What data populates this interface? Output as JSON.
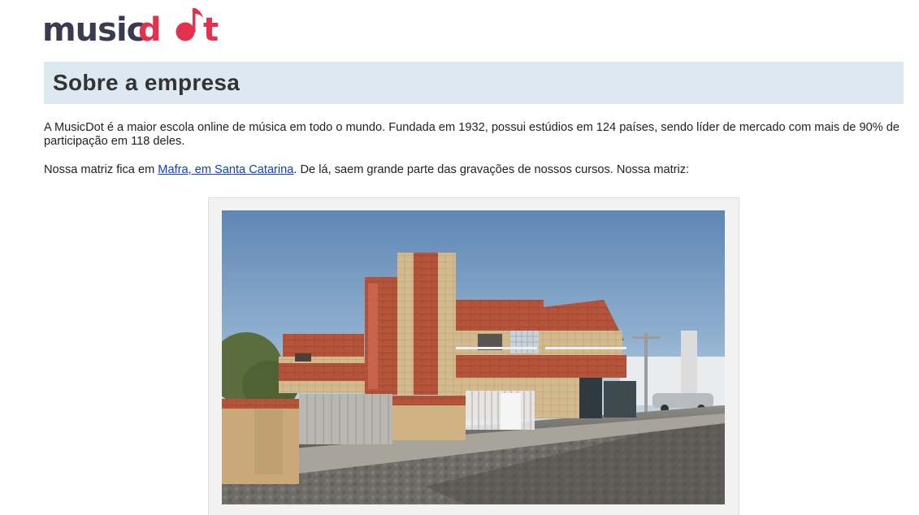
{
  "logo": {
    "text_main": "music",
    "text_accent_1": "d",
    "text_accent_2": "t",
    "alt": "musicdot",
    "colors": {
      "main": "#3b3b4f",
      "accent": "#e2324e"
    }
  },
  "section": {
    "title": "Sobre a empresa",
    "background": "#dce9f0"
  },
  "paragraphs": {
    "p1": "A MusicDot é a maior escola online de música em todo o mundo. Fundada em 1932, possui estúdios em 124 países, sendo líder de mercado com mais de 90% de participação em 118 deles.",
    "p2_before": "Nossa matriz fica em ",
    "p2_link": "Mafra, em Santa Catarina",
    "p2_after": ". De lá, saem grande parte das gravações de nossos cursos. Nossa matriz:"
  },
  "figure": {
    "image_label": "street-view-photo-of-headquarters-building"
  }
}
